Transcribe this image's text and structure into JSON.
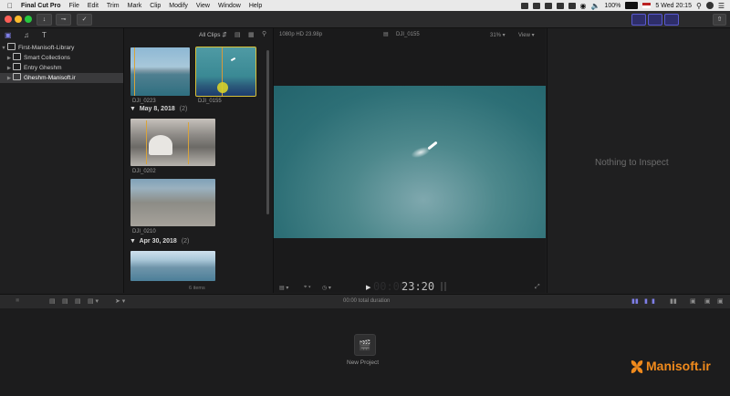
{
  "menubar": {
    "app_name": "Final Cut Pro",
    "items": [
      "File",
      "Edit",
      "Trim",
      "Mark",
      "Clip",
      "Modify",
      "View",
      "Window",
      "Help"
    ],
    "battery": "100%",
    "clock": "5 Wed 20:15"
  },
  "sidebar": {
    "items": [
      {
        "label": "First-Manisoft-Library"
      },
      {
        "label": "Smart Collections"
      },
      {
        "label": "Entry Gheshm"
      },
      {
        "label": "Gheshm-Manisoft.ir"
      }
    ]
  },
  "browser": {
    "filter": "All Clips",
    "clips_top": [
      {
        "name": "DJI_0223"
      },
      {
        "name": "DJI_0155"
      }
    ],
    "groups": [
      {
        "date": "May 8, 2018",
        "count": "(2)",
        "clips": [
          {
            "name": "DJI_0202"
          },
          {
            "name": "DJI_0210"
          }
        ]
      },
      {
        "date": "Apr 30, 2018",
        "count": "(2)"
      }
    ],
    "footer": "6 items"
  },
  "viewer": {
    "format": "1080p HD 23.98p",
    "clip_name": "DJI_0155",
    "zoom": "31%",
    "view_menu": "View",
    "timecode": "23:20"
  },
  "inspector": {
    "empty_text": "Nothing to Inspect"
  },
  "timeline": {
    "total_duration": "00:00 total duration",
    "new_project": "New Project"
  },
  "watermark": {
    "text": "Manisoft.ir"
  },
  "colors": {
    "accent": "#6b6bff",
    "selection": "#3a3a3c",
    "watermark": "#f08a1c"
  }
}
